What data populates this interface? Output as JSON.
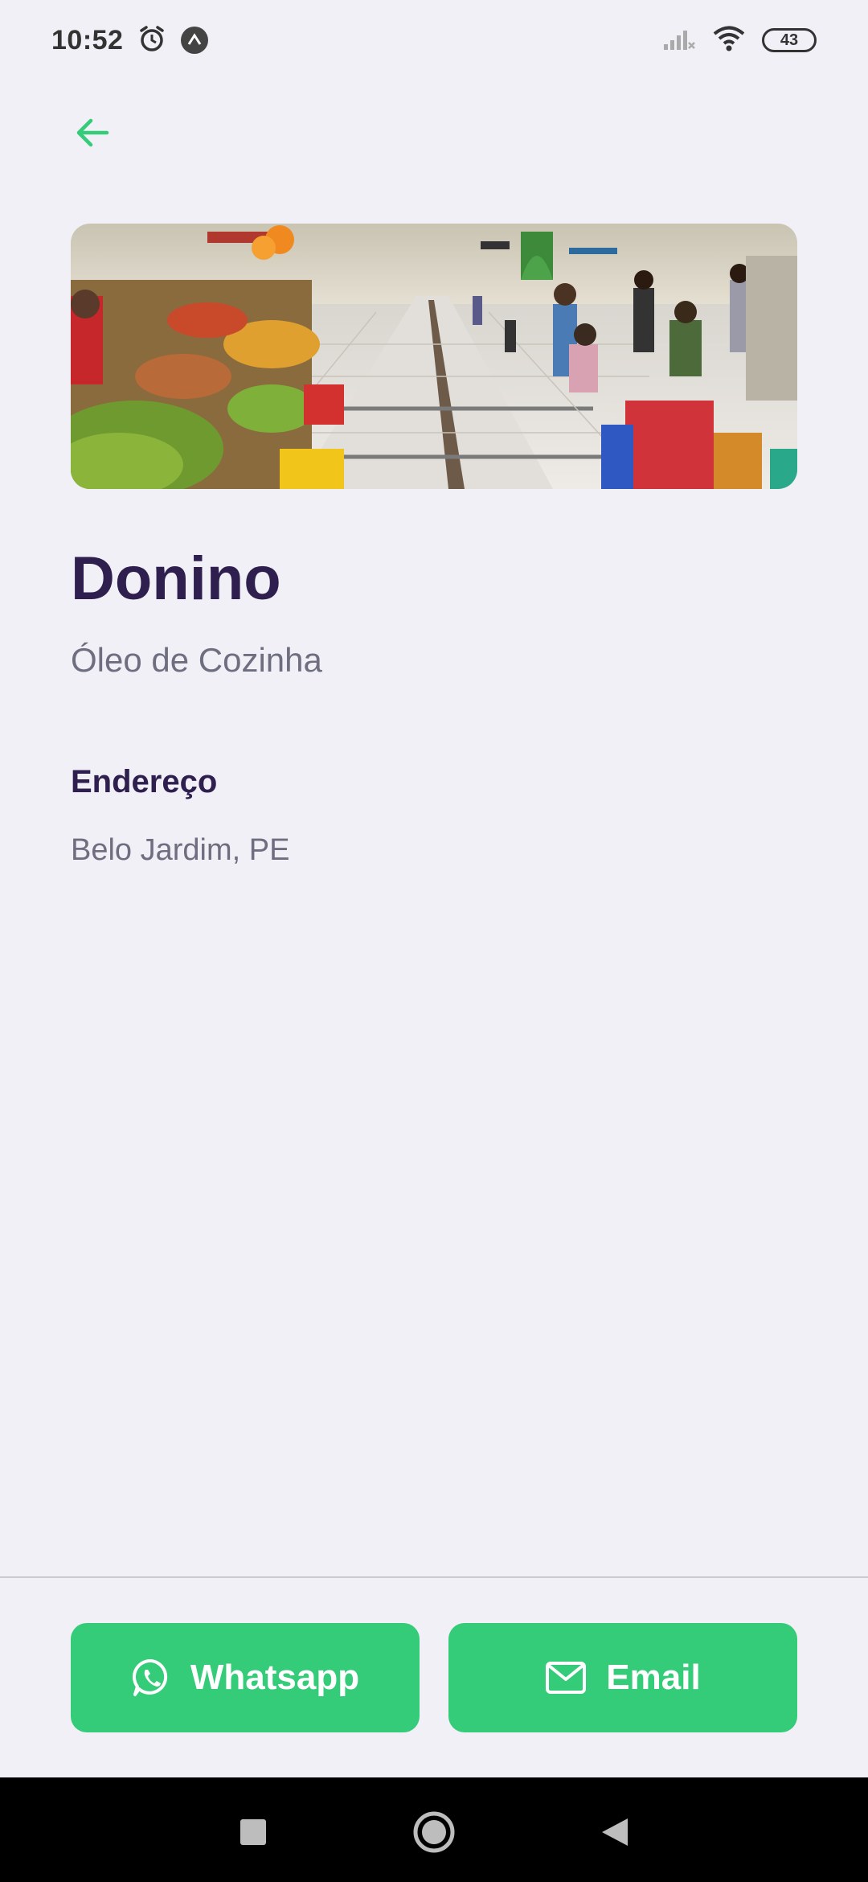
{
  "status_bar": {
    "time": "10:52",
    "battery": "43",
    "icons": [
      "alarm-icon",
      "app-notification-icon",
      "signal-icon",
      "wifi-icon",
      "battery-icon"
    ]
  },
  "header": {
    "back_icon": "arrow-left-icon",
    "accent_color": "#34cb79"
  },
  "store": {
    "name": "Donino",
    "category": "Óleo de Cozinha",
    "address_label": "Endereço",
    "address": "Belo Jardim, PE"
  },
  "actions": {
    "whatsapp_label": "Whatsapp",
    "email_label": "Email",
    "button_color": "#34cb79"
  },
  "nav": {
    "icons": [
      "recents-square-icon",
      "home-circle-icon",
      "back-triangle-icon"
    ]
  }
}
